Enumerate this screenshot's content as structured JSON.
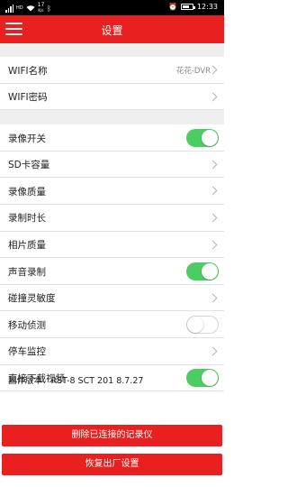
{
  "status_bar": {
    "carrier_badge": "HD",
    "net_speed": "17",
    "net_speed_unit": "K/s",
    "time": "12:33",
    "battery_level": 0.7,
    "icons": [
      "signal-icon",
      "wifi-icon",
      "bluetooth-icon",
      "alarm-icon",
      "battery-icon"
    ]
  },
  "app_bar": {
    "title": "设置",
    "menu_icon": "menu-icon",
    "color": "#e8201f"
  },
  "sections": {
    "wifi": [
      {
        "label": "WIFI名称",
        "value": "花花-DVR",
        "control": "chevron"
      },
      {
        "label": "WIFI密码",
        "value": "",
        "control": "chevron"
      }
    ],
    "recording": [
      {
        "label": "录像开关",
        "control": "toggle",
        "on": true
      },
      {
        "label": "SD卡容量",
        "control": "chevron"
      },
      {
        "label": "录像质量",
        "control": "chevron"
      },
      {
        "label": "录制时长",
        "control": "chevron"
      },
      {
        "label": "相片质量",
        "control": "chevron"
      },
      {
        "label": "声音录制",
        "control": "toggle",
        "on": true
      },
      {
        "label": "碰撞灵敏度",
        "control": "chevron"
      },
      {
        "label": "移动侦测",
        "control": "toggle",
        "on": false
      },
      {
        "label": "停车监控",
        "control": "chevron"
      },
      {
        "label": "直接下载视频",
        "control": "toggle",
        "on": true
      }
    ]
  },
  "firmware": "固件版本：RST-8 SCT 201 8.7.27",
  "buttons": {
    "delete_label": "删除已连接的记录仪",
    "reset_label": "恢复出厂设置"
  },
  "colors": {
    "accent": "#e8201f",
    "toggle_on": "#4ccd62"
  }
}
